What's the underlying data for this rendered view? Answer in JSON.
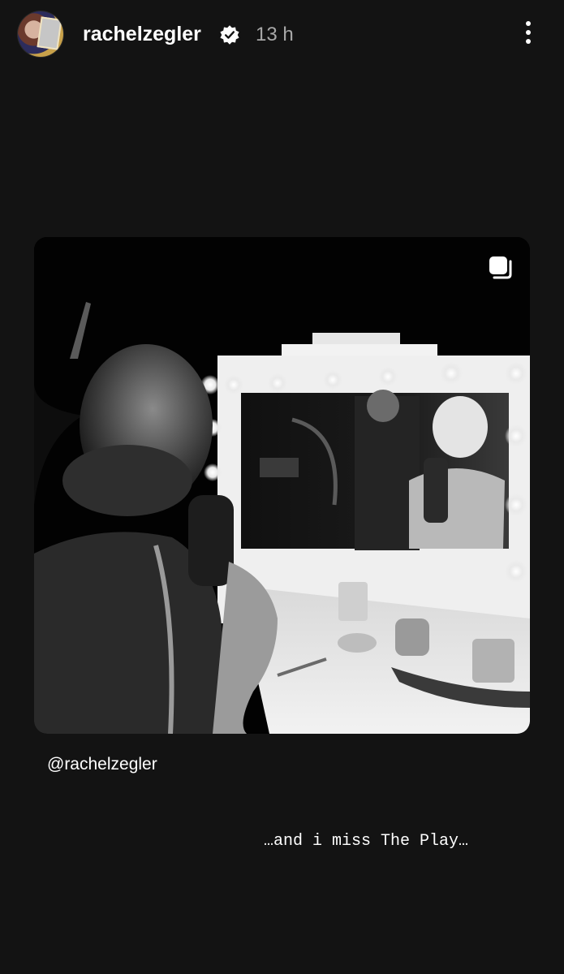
{
  "header": {
    "username": "rachelzegler",
    "timestamp": "13 h",
    "verified_icon": "verified-badge-icon",
    "menu_icon": "more-vertical-icon"
  },
  "post": {
    "image_description_icon": "multiple-posts-icon"
  },
  "sticker": {
    "mention": "@rachelzegler"
  },
  "caption": {
    "text": "…and i miss The Play…"
  },
  "colors": {
    "background": "#131313",
    "text": "#ffffff",
    "muted": "#a8a8a8"
  }
}
